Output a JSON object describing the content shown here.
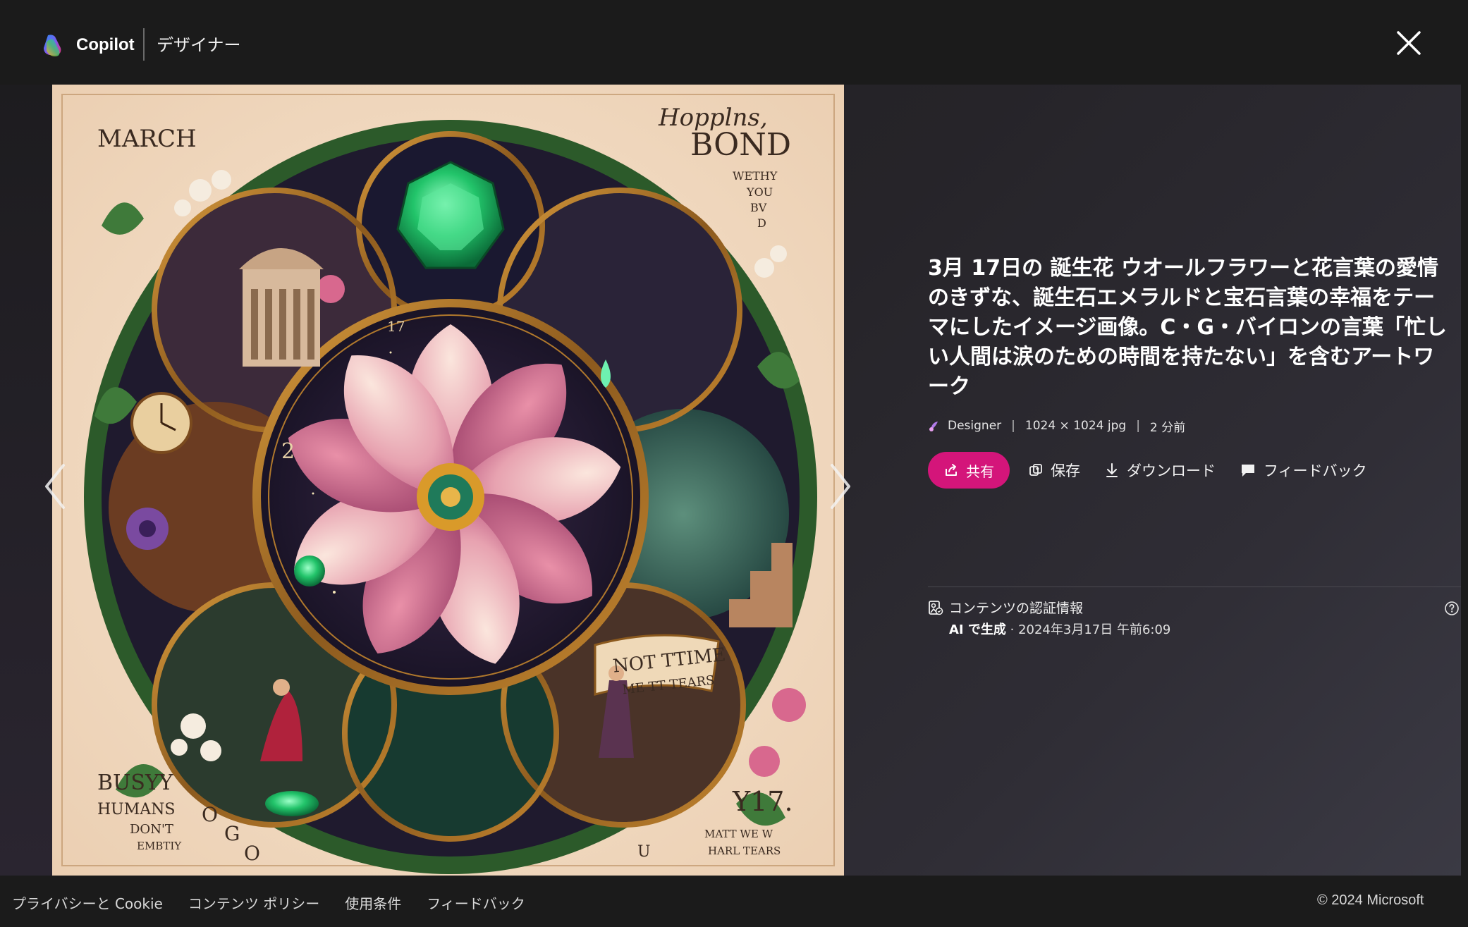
{
  "header": {
    "brand": "Copilot",
    "product": "デザイナー"
  },
  "artwork": {
    "texts": {
      "march": "MARCH",
      "hopping": "Hopplns,",
      "bond": "BOND",
      "weth1": "WETHY",
      "weth2": "YOU",
      "weth3": "BV",
      "weth4": "D",
      "busy1": "BUSYY",
      "busy2": "HUMANS",
      "busy3": "DON'T",
      "busy4": "EMBTIY",
      "og1": "O",
      "og2": "G",
      "og3": "O",
      "y17": "Y17.",
      "matt1": "MATT WE W",
      "matt2": "HARL TEARS",
      "u": "U",
      "notime1": "NOT TTIME",
      "notime2": "ME TT TEARS",
      "num17": "17",
      "num2": "2"
    }
  },
  "info": {
    "title": "3月 17日の 誕生花 ウオールフラワーと花言葉の愛情のきずな、誕生石エメラルドと宝石言葉の幸福をテーマにしたイメージ画像。C・G・バイロンの言葉「忙しい人間は涙のための時間を持たない」を含むアートワーク",
    "meta": {
      "source": "Designer",
      "size": "1024 × 1024 jpg",
      "time": "2 分前",
      "sep": "|"
    },
    "actions": {
      "share": "共有",
      "save": "保存",
      "download": "ダウンロード",
      "feedback": "フィードバック"
    },
    "credentials": {
      "label": "コンテンツの認証情報",
      "ai_label": "AI で生成",
      "date": " · 2024年3月17日 午前6:09"
    }
  },
  "footer": {
    "links": [
      "プライバシーと Cookie",
      "コンテンツ ポリシー",
      "使用条件",
      "フィードバック"
    ],
    "copyright": "© 2024 Microsoft"
  },
  "colors": {
    "accent": "#d4157a",
    "background": "#1b1b1b",
    "artwork_paper": "#f3dcc4"
  },
  "icons": {
    "logo": "copilot-logo-icon",
    "close": "close-icon",
    "prev": "chevron-left-icon",
    "next": "chevron-right-icon",
    "share": "share-icon",
    "save": "save-icon",
    "download": "download-icon",
    "feedback": "feedback-icon",
    "credentials": "content-credentials-icon",
    "help": "help-icon"
  }
}
